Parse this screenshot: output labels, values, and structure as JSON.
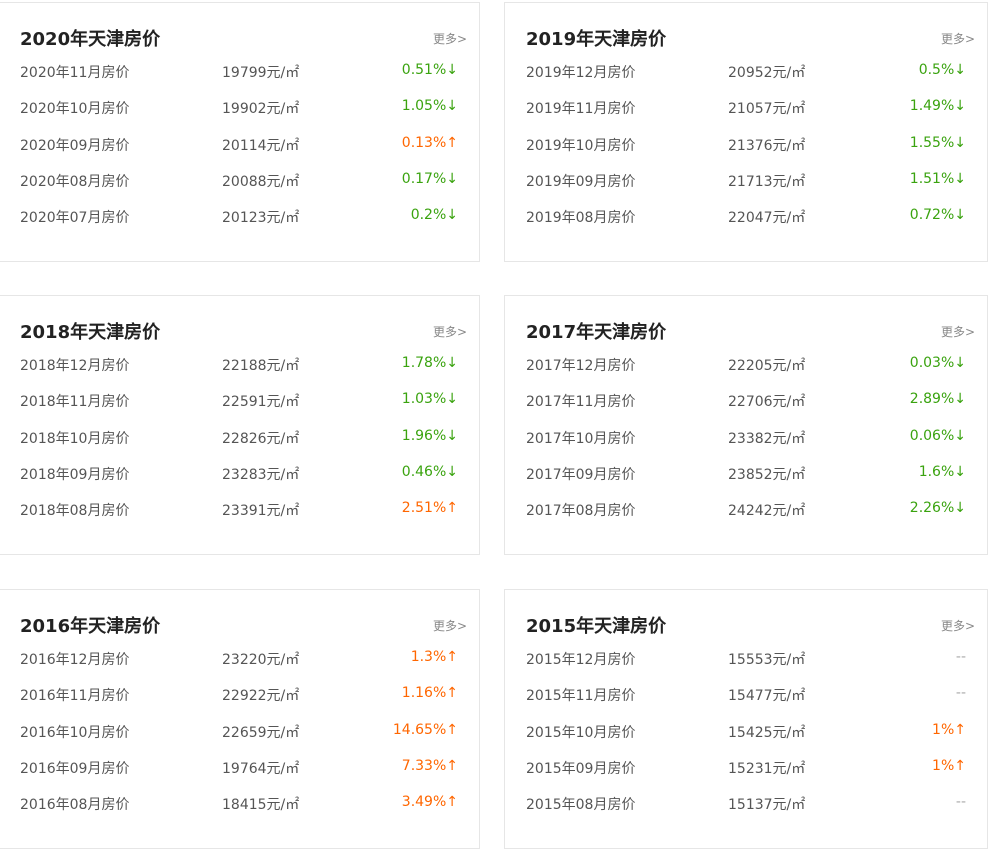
{
  "colors": {
    "down": "#3aa30f",
    "up": "#ff6600",
    "none": "#aaaaaa"
  },
  "cards": [
    {
      "title": "2020年天津房价",
      "more": "更多>",
      "rows": [
        {
          "month": "2020年11月房价",
          "price": "19799元/㎡",
          "change": "0.51%↓",
          "trend": "down"
        },
        {
          "month": "2020年10月房价",
          "price": "19902元/㎡",
          "change": "1.05%↓",
          "trend": "down"
        },
        {
          "month": "2020年09月房价",
          "price": "20114元/㎡",
          "change": "0.13%↑",
          "trend": "up"
        },
        {
          "month": "2020年08月房价",
          "price": "20088元/㎡",
          "change": "0.17%↓",
          "trend": "down"
        },
        {
          "month": "2020年07月房价",
          "price": "20123元/㎡",
          "change": "0.2%↓",
          "trend": "down"
        }
      ]
    },
    {
      "title": "2019年天津房价",
      "more": "更多>",
      "rows": [
        {
          "month": "2019年12月房价",
          "price": "20952元/㎡",
          "change": "0.5%↓",
          "trend": "down"
        },
        {
          "month": "2019年11月房价",
          "price": "21057元/㎡",
          "change": "1.49%↓",
          "trend": "down"
        },
        {
          "month": "2019年10月房价",
          "price": "21376元/㎡",
          "change": "1.55%↓",
          "trend": "down"
        },
        {
          "month": "2019年09月房价",
          "price": "21713元/㎡",
          "change": "1.51%↓",
          "trend": "down"
        },
        {
          "month": "2019年08月房价",
          "price": "22047元/㎡",
          "change": "0.72%↓",
          "trend": "down"
        }
      ]
    },
    {
      "title": "2018年天津房价",
      "more": "更多>",
      "rows": [
        {
          "month": "2018年12月房价",
          "price": "22188元/㎡",
          "change": "1.78%↓",
          "trend": "down"
        },
        {
          "month": "2018年11月房价",
          "price": "22591元/㎡",
          "change": "1.03%↓",
          "trend": "down"
        },
        {
          "month": "2018年10月房价",
          "price": "22826元/㎡",
          "change": "1.96%↓",
          "trend": "down"
        },
        {
          "month": "2018年09月房价",
          "price": "23283元/㎡",
          "change": "0.46%↓",
          "trend": "down"
        },
        {
          "month": "2018年08月房价",
          "price": "23391元/㎡",
          "change": "2.51%↑",
          "trend": "up"
        }
      ]
    },
    {
      "title": "2017年天津房价",
      "more": "更多>",
      "rows": [
        {
          "month": "2017年12月房价",
          "price": "22205元/㎡",
          "change": "0.03%↓",
          "trend": "down"
        },
        {
          "month": "2017年11月房价",
          "price": "22706元/㎡",
          "change": "2.89%↓",
          "trend": "down"
        },
        {
          "month": "2017年10月房价",
          "price": "23382元/㎡",
          "change": "0.06%↓",
          "trend": "down"
        },
        {
          "month": "2017年09月房价",
          "price": "23852元/㎡",
          "change": "1.6%↓",
          "trend": "down"
        },
        {
          "month": "2017年08月房价",
          "price": "24242元/㎡",
          "change": "2.26%↓",
          "trend": "down"
        }
      ]
    },
    {
      "title": "2016年天津房价",
      "more": "更多>",
      "rows": [
        {
          "month": "2016年12月房价",
          "price": "23220元/㎡",
          "change": "1.3%↑",
          "trend": "up"
        },
        {
          "month": "2016年11月房价",
          "price": "22922元/㎡",
          "change": "1.16%↑",
          "trend": "up"
        },
        {
          "month": "2016年10月房价",
          "price": "22659元/㎡",
          "change": "14.65%↑",
          "trend": "up"
        },
        {
          "month": "2016年09月房价",
          "price": "19764元/㎡",
          "change": "7.33%↑",
          "trend": "up"
        },
        {
          "month": "2016年08月房价",
          "price": "18415元/㎡",
          "change": "3.49%↑",
          "trend": "up"
        }
      ]
    },
    {
      "title": "2015年天津房价",
      "more": "更多>",
      "rows": [
        {
          "month": "2015年12月房价",
          "price": "15553元/㎡",
          "change": "--",
          "trend": "none"
        },
        {
          "month": "2015年11月房价",
          "price": "15477元/㎡",
          "change": "--",
          "trend": "none"
        },
        {
          "month": "2015年10月房价",
          "price": "15425元/㎡",
          "change": "1%↑",
          "trend": "up"
        },
        {
          "month": "2015年09月房价",
          "price": "15231元/㎡",
          "change": "1%↑",
          "trend": "up"
        },
        {
          "month": "2015年08月房价",
          "price": "15137元/㎡",
          "change": "--",
          "trend": "none"
        }
      ]
    }
  ]
}
